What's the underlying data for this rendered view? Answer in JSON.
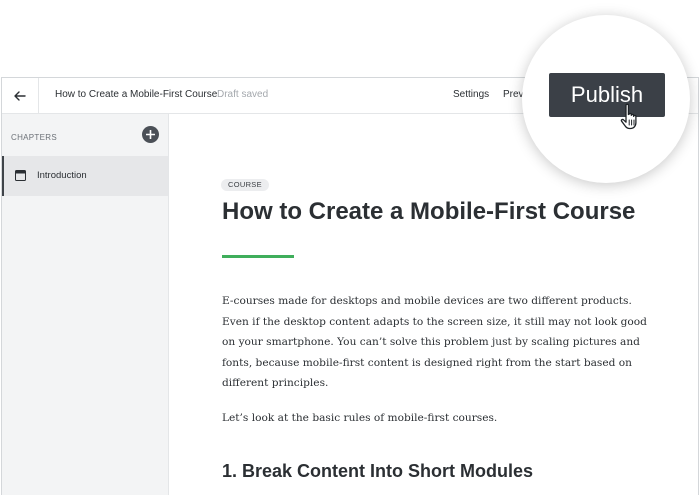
{
  "topbar": {
    "back_icon": "arrow-left-icon",
    "course_title": "How to Create a Mobile-First Course",
    "draft_status": "Draft saved",
    "settings_label": "Settings",
    "preview_label": "Previ",
    "publish_label": "Publish"
  },
  "sidebar": {
    "chapters_label": "CHAPTERS",
    "add_icon": "plus-circle-icon",
    "items": [
      {
        "label": "Introduction",
        "icon": "layout-icon"
      }
    ]
  },
  "content": {
    "badge": "COURSE",
    "title": "How to Create a Mobile-First Course",
    "paragraphs": [
      "E-courses made for desktops and mobile devices are two different products. Even if the desktop content adapts to the screen size, it still may not look good on your smartphone. You can’t solve this problem just by scaling pictures and fonts, because mobile-first content is designed right from the start based on different principles.",
      "Let’s look at the basic rules of mobile-first courses."
    ],
    "subheading": "1. Break Content Into Short Modules"
  },
  "colors": {
    "accent": "#3fae5b",
    "dark_button": "#3b4047",
    "sidebar_bg": "#f3f4f5"
  }
}
